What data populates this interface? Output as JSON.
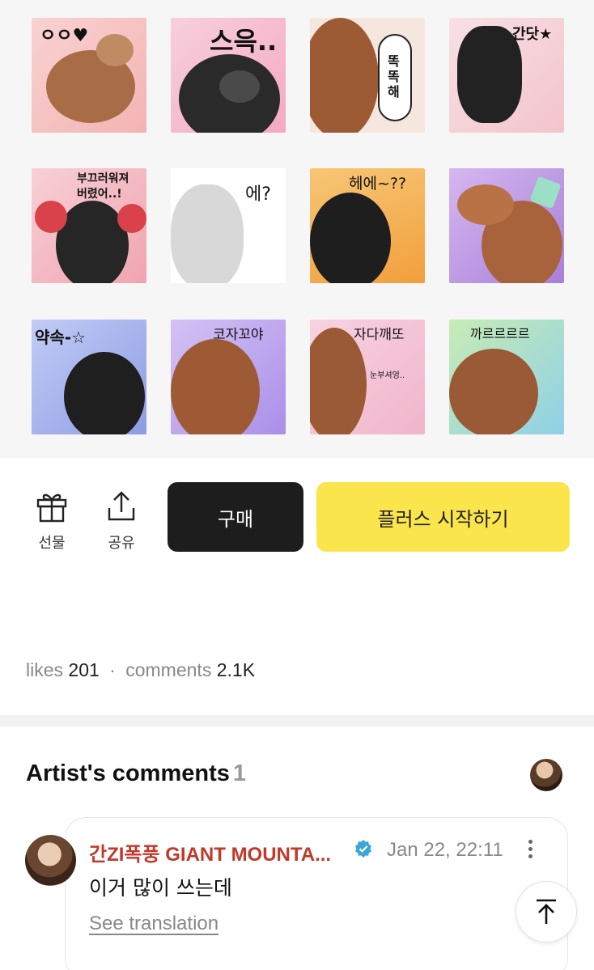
{
  "stickers": [
    {
      "caption": "ㅇㅇ♥",
      "bg": "#f7c9c9"
    },
    {
      "caption": "스윽..",
      "bg": "#f6c6d6"
    },
    {
      "caption": "똑\n똑\n해",
      "bg": "#f8e6dc"
    },
    {
      "caption": "간닷★",
      "bg": "#f6d7dd"
    },
    {
      "caption": "부끄러워져\n버렸어..!",
      "bg": "#f4b9c2"
    },
    {
      "caption": "에?",
      "bg": "#ffffff"
    },
    {
      "caption": "헤에~??",
      "bg": "#f5b75a"
    },
    {
      "caption": "",
      "bg": "#c6a3e8"
    },
    {
      "caption": "약속-☆",
      "bg": "#a9b8f0"
    },
    {
      "caption": "코자꼬야",
      "bg": "#c7b3f0"
    },
    {
      "caption": "자다깨또",
      "bg": "#f4c3d6"
    },
    {
      "caption": "까르르르르",
      "bg": "#b8e2a6"
    }
  ],
  "sticker_sub": {
    "s10": "눈부셔엉.."
  },
  "actions": {
    "gift_label": "선물",
    "share_label": "공유",
    "buy_label": "구매",
    "plus_label": "플러스 시작하기"
  },
  "stats": {
    "likes_label": "likes",
    "likes_value": "201",
    "separator": "·",
    "comments_label": "comments",
    "comments_value": "2.1K"
  },
  "artist_comments": {
    "title": "Artist's comments",
    "count": "1"
  },
  "comment": {
    "author": "간ZI폭풍 GIANT MOUNTA...",
    "date": "Jan 22, 22:11",
    "text": "이거 많이 쓰는데",
    "see_translation": "See translation"
  },
  "colors": {
    "buy_bg": "#1d1d1d",
    "plus_bg": "#fbe54d",
    "author": "#c0392b",
    "verified": "#3aa7d8"
  }
}
